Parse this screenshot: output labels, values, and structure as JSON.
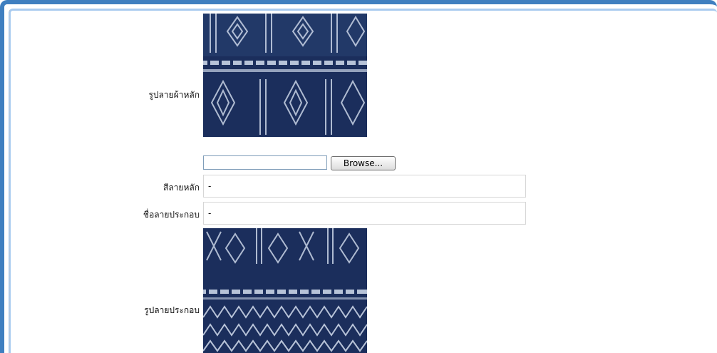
{
  "form": {
    "main_pattern_image_label": "รูปลายผ้าหลัก",
    "file_input_value": "",
    "browse_button_label": "Browse...",
    "main_color_label": "สีลายหลัก",
    "main_color_value": "-",
    "secondary_pattern_name_label": "ชื่อลายประกอบ",
    "secondary_pattern_name_value": "-",
    "secondary_pattern_image_label": "รูปลายประกอบ"
  },
  "colors": {
    "frame_border": "#3f7fc0",
    "fabric_base": "#1b2e5c",
    "fabric_pattern": "#c9d4e6"
  }
}
